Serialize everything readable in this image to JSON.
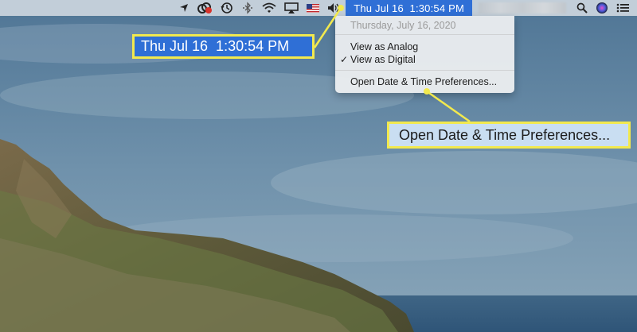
{
  "menubar": {
    "icons": [
      "location-arrow-icon",
      "creative-cloud-icon",
      "time-machine-icon",
      "bluetooth-icon",
      "wifi-icon",
      "airplay-icon",
      "us-flag-icon",
      "volume-icon"
    ],
    "clock": "Thu Jul 16  1:30:54 PM",
    "right_icons": [
      "spotlight-icon",
      "siri-icon",
      "notification-center-icon"
    ],
    "highlight_color": "#2f6fd6"
  },
  "dropdown": {
    "date": "Thursday, July 16, 2020",
    "view_analog": "View as Analog",
    "view_digital": "View as Digital",
    "checkmark": "✓",
    "open_prefs": "Open Date & Time Preferences..."
  },
  "callouts": {
    "clock": "Thu Jul 16  1:30:54 PM",
    "prefs": "Open Date & Time Preferences...",
    "border_color": "#f2e94e"
  }
}
